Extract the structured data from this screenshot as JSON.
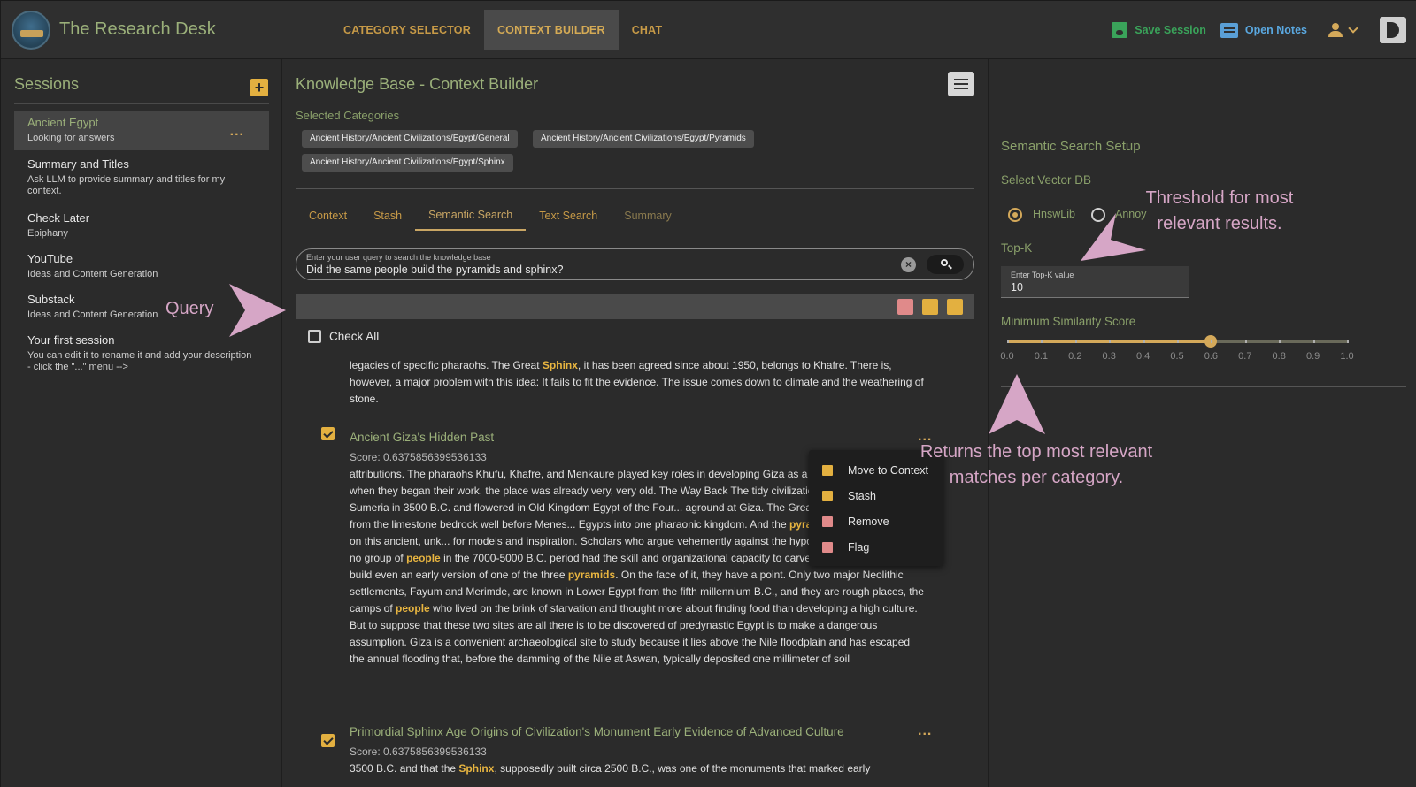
{
  "app": {
    "title": "The Research Desk"
  },
  "nav": {
    "tabs": [
      {
        "label": "CATEGORY SELECTOR"
      },
      {
        "label": "CONTEXT BUILDER"
      },
      {
        "label": "CHAT"
      }
    ]
  },
  "top_actions": {
    "save_label": "Save Session",
    "notes_label": "Open Notes"
  },
  "sidebar": {
    "title": "Sessions",
    "add_label": "+",
    "sessions": [
      {
        "title": "Ancient Egypt",
        "desc": "Looking for answers"
      },
      {
        "title": "Summary and Titles",
        "desc": "Ask LLM to provide summary and titles for my context."
      },
      {
        "title": "Check Later",
        "desc": "Epiphany"
      },
      {
        "title": "YouTube",
        "desc": "Ideas and Content Generation"
      },
      {
        "title": "Substack",
        "desc": "Ideas and Content Generation"
      },
      {
        "title": "Your first session",
        "desc": "You can edit it to rename it and add your description - click the \"...\" menu -->"
      }
    ],
    "more_label": "..."
  },
  "main": {
    "title": "Knowledge Base - Context Builder",
    "selected_label": "Selected Categories",
    "categories": [
      "Ancient History/Ancient Civilizations/Egypt/General",
      "Ancient History/Ancient Civilizations/Egypt/Pyramids",
      "Ancient History/Ancient Civilizations/Egypt/Sphinx"
    ],
    "subtabs": [
      {
        "label": "Context"
      },
      {
        "label": "Stash"
      },
      {
        "label": "Semantic Search"
      },
      {
        "label": "Text Search"
      },
      {
        "label": "Summary"
      }
    ],
    "search": {
      "placeholder": "Enter your user query to search the knowledge base",
      "value": "Did the same people build the pyramids and sphinx?"
    },
    "check_all_label": "Check All",
    "results": [
      {
        "title": "Ancient Giza's Hidden Past",
        "score": "Score: 0.6375856399536133"
      },
      {
        "title": "Primordial Sphinx Age Origins of Civilization's Monument Early Evidence of Advanced Culture",
        "score": "Score: 0.6375856399536133"
      }
    ],
    "more_label": "..."
  },
  "context_menu": {
    "items": [
      {
        "label": "Move to Context"
      },
      {
        "label": "Stash"
      },
      {
        "label": "Remove"
      },
      {
        "label": "Flag"
      }
    ]
  },
  "right_panel": {
    "title": "Semantic Search Setup",
    "vector_db_label": "Select Vector DB",
    "vector_dbs": [
      {
        "label": "HnswLib",
        "selected": true
      },
      {
        "label": "Annoy",
        "selected": false
      }
    ],
    "topk_label": "Top-K",
    "topk_placeholder": "Enter Top-K value",
    "topk_value": "10",
    "similarity_label": "Minimum Similarity Score",
    "similarity_value": 0.6,
    "similarity_ticks": [
      "0.0",
      "0.1",
      "0.2",
      "0.3",
      "0.4",
      "0.5",
      "0.6",
      "0.7",
      "0.8",
      "0.9",
      "1.0"
    ]
  },
  "annotations": {
    "query": "Query",
    "threshold": "Threshold for most relevant results.",
    "topk": "Returns the top most relevant matches per category."
  },
  "colors": {
    "accent": "#d4a95a",
    "green": "#9bb07a",
    "highlight": "#e8b540",
    "annotation": "#d6a6c6"
  },
  "icons": [
    "logo",
    "save-icon",
    "notes-icon",
    "user-icon",
    "chevron-down-icon",
    "theme-toggle-icon",
    "hamburger-icon",
    "clear-icon",
    "search-icon",
    "delete-icon",
    "stash-icon",
    "add-to-context-icon",
    "flag-icon"
  ]
}
